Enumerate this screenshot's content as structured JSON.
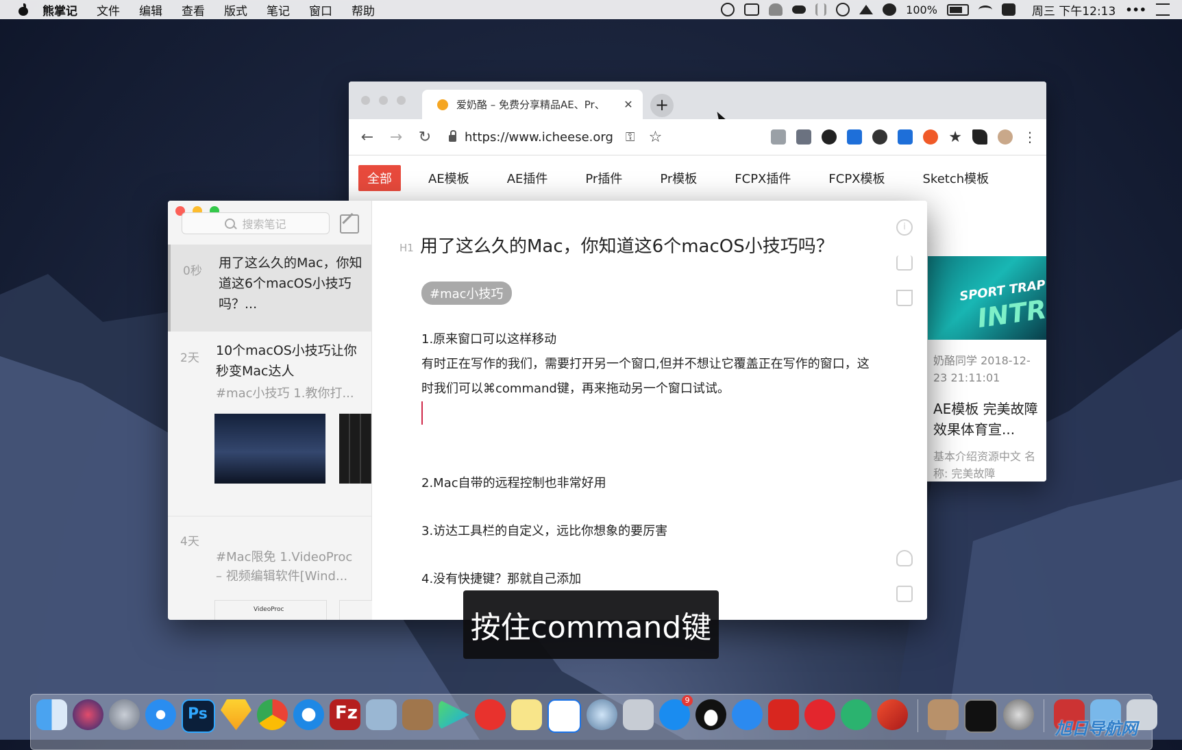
{
  "menubar": {
    "app_name": "熊掌记",
    "menus": [
      "文件",
      "编辑",
      "查看",
      "版式",
      "笔记",
      "窗口",
      "帮助"
    ],
    "battery": "100%",
    "clock": "周三 下午12:13",
    "more": "•••"
  },
  "browser": {
    "tab_title": "爱奶酪 – 免费分享精品AE、Pr、",
    "tab_close": "✕",
    "new_tab": "+",
    "url": "https://www.icheese.org",
    "nav": {
      "active": "全部",
      "items": [
        "AE模板",
        "AE插件",
        "Pr插件",
        "Pr模板",
        "FCPX插件",
        "FCPX模板",
        "Sketch模板"
      ]
    },
    "card": {
      "image_text_1": "SPORT TRAP",
      "image_text_2": "INTRO",
      "meta": "奶酪同学   2018-12-23 21:11:01",
      "title": "AE模板 完美故障效果体育宣...",
      "desc": "基本介绍资源中文 名称: 完美故障"
    }
  },
  "bear": {
    "search_placeholder": "搜索笔记",
    "notes": [
      {
        "age": "0秒",
        "title": "用了这么久的Mac，你知道这6个macOS小技巧吗？...",
        "subtitle": ""
      },
      {
        "age": "2天",
        "title": "10个macOS小技巧让你秒变Mac达人",
        "subtitle": "#mac小技巧 1.教你打..."
      },
      {
        "age": "4天",
        "title": "",
        "subtitle": "#Mac限免 1.VideoProc – 视频编辑软件[Wind..."
      }
    ],
    "thumb_text": "VideoProc",
    "editor": {
      "heading_marker": "H1",
      "title": "用了这么久的Mac，你知道这6个macOS小技巧吗？",
      "tag": "#mac小技巧",
      "p1_heading": "1.原来窗口可以这样移动",
      "p1_body": "有时正在写作的我们，需要打开另一个窗口,但并不想让它覆盖正在写作的窗口，这时我们可以⌘command键，再来拖动另一个窗口试试。",
      "p2": "2.Mac自带的远程控制也非常好用",
      "p3": "3.访达工具栏的自定义，远比你想象的要厉害",
      "p4": "4.没有快捷键？那就自己添加"
    }
  },
  "subtitle": "按住command键",
  "dock": {
    "app_store_badge": "9",
    "watermark": "旭日导航网"
  },
  "colors": {
    "accent_red": "#e84a3c",
    "caret": "#d0294a",
    "traffic_close": "#fc5f57",
    "traffic_min": "#fdbc2e",
    "traffic_max": "#34c84a"
  }
}
